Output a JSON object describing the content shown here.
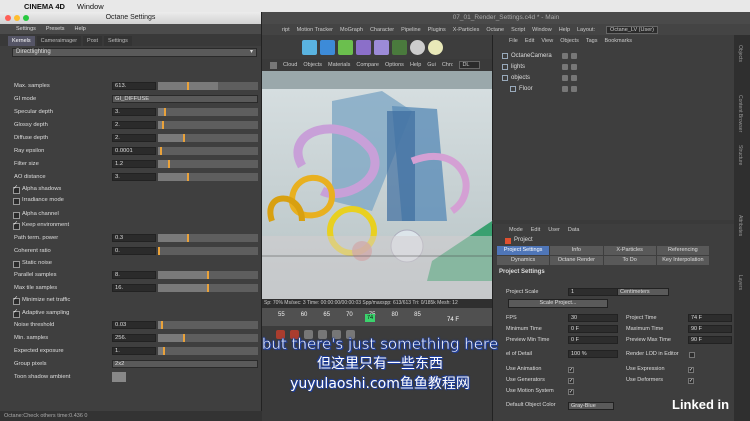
{
  "mac_menu": {
    "app": "CINEMA 4D",
    "window": "Window"
  },
  "c4d": {
    "title": "07_01_Render_Settings.c4d * - Main",
    "menus": [
      "ript",
      "Motion Tracker",
      "MoGraph",
      "Character",
      "Pipeline",
      "Plugins",
      "X-Particles",
      "Octane",
      "Script",
      "Window",
      "Help"
    ],
    "layout_label": "Layout:",
    "layout_value": "Octane_LV (User)"
  },
  "octane": {
    "title": "Octane Settings",
    "menu": [
      "Settings",
      "Presets",
      "Help"
    ],
    "tabs": [
      "Kernels",
      "Cameraimager",
      "Post",
      "Settings"
    ],
    "kernel": "Directlighting",
    "params": [
      {
        "label": "Max. samples",
        "value": "613.",
        "fill": 0.6,
        "mk": 0.3
      },
      {
        "label": "GI mode",
        "value": "GI_DIFFUSE",
        "select": true
      },
      {
        "label": "Specular depth",
        "value": "3.",
        "fill": 0.06,
        "mk": 0.06
      },
      {
        "label": "Glossy depth",
        "value": "2.",
        "fill": 0.04,
        "mk": 0.04
      },
      {
        "label": "Diffuse depth",
        "value": "2.",
        "fill": 0.25,
        "mk": 0.25
      },
      {
        "label": "Ray epsilon",
        "value": "0.0001",
        "fill": 0.02,
        "mk": 0.02
      },
      {
        "label": "Filter size",
        "value": "1.2",
        "fill": 0.1,
        "mk": 0.1
      },
      {
        "label": "AO distance",
        "value": "3.",
        "fill": 0.3,
        "mk": 0.3
      }
    ],
    "checks1": [
      {
        "label": "Alpha shadows",
        "on": true
      },
      {
        "label": "Irradiance mode",
        "on": false
      }
    ],
    "checks2": [
      {
        "label": "Alpha channel",
        "on": false
      },
      {
        "label": "Keep environment",
        "on": true
      }
    ],
    "params2": [
      {
        "label": "Path term. power",
        "value": "0.3",
        "fill": 0.3,
        "mk": 0.3
      },
      {
        "label": "Coherent ratio",
        "value": "0.",
        "fill": 0.0,
        "mk": 0.0
      }
    ],
    "check3": {
      "label": "Static noise",
      "on": false
    },
    "params3": [
      {
        "label": "Parallel samples",
        "value": "8.",
        "fill": 0.5,
        "mk": 0.5
      },
      {
        "label": "Max tile samples",
        "value": "16.",
        "fill": 0.5,
        "mk": 0.5
      }
    ],
    "check4": {
      "label": "Minimize net traffic",
      "on": true
    },
    "check5": {
      "label": "Adaptive sampling",
      "on": true
    },
    "params4": [
      {
        "label": "Noise threshold",
        "value": "0.03",
        "fill": 0.03,
        "mk": 0.03
      },
      {
        "label": "Min. samples",
        "value": "256.",
        "fill": 0.25,
        "mk": 0.25
      },
      {
        "label": "Expected exposure",
        "value": "1.",
        "fill": 0.05,
        "mk": 0.05
      }
    ],
    "group_pixels": {
      "label": "Group pixels",
      "value": "2x2"
    },
    "toon": {
      "label": "Toon shadow ambient"
    },
    "status": "Octane:Check others time:0.436  0"
  },
  "viewport": {
    "menu": [
      "Cloud",
      "Objects",
      "Materials",
      "Compare",
      "Options",
      "Help",
      "Gui"
    ],
    "chn_label": "Chn:",
    "chn_value": "DL",
    "stats": "Sp: 70%   Ms/sec: 3   Time: 00:00:00/00:00:03   Spp/maxspp: 613/613   Tri: 0/185k   Mesh: 12"
  },
  "timeline": {
    "nums": [
      "55",
      "60",
      "65",
      "70",
      "75",
      "80",
      "85"
    ],
    "current": "74",
    "end": "74 F"
  },
  "objects": {
    "menu": [
      "File",
      "Edit",
      "View",
      "Objects",
      "Tags",
      "Bookmarks"
    ],
    "items": [
      "OctaneCamera",
      "lights",
      "objects",
      "Floor"
    ]
  },
  "attributes": {
    "menu": [
      "Mode",
      "Edit",
      "User",
      "Data"
    ],
    "header": "Project",
    "tabs": [
      "Project Settings",
      "Info",
      "X-Particles",
      "Referencing",
      "Dynamics",
      "Octane Render",
      "To Do",
      "Key Interpolation"
    ],
    "section": "Project Settings",
    "scale_label": "Project Scale",
    "scale_value": "1",
    "scale_unit": "Centimeters",
    "scale_btn": "Scale Project...",
    "fields": [
      {
        "label": "FPS",
        "value": "30",
        "label2": "Project Time",
        "value2": "74 F"
      },
      {
        "label": "Minimum Time",
        "value": "0 F",
        "label2": "Maximum Time",
        "value2": "90 F"
      },
      {
        "label": "Preview Min Time",
        "value": "0 F",
        "label2": "Preview Max Time",
        "value2": "90 F"
      }
    ],
    "lod_label": "el of Detail",
    "lod_value": "100 %",
    "lod_check": "Render LOD in Editor",
    "checks": [
      {
        "label": "Use Animation",
        "label2": "Use Expression"
      },
      {
        "label": "Use Generators",
        "label2": "Use Deformers"
      },
      {
        "label": "Use Motion System",
        "label2": ""
      }
    ],
    "color_label": "Default Object Color",
    "color_value": "Gray-Blue"
  },
  "side_tabs": [
    "Objects",
    "Content Browser",
    "Structure",
    "Attributes",
    "Layers"
  ],
  "subtitles": {
    "en": "but there's just something here",
    "zh": "但这里只有一些东西",
    "wm": "yuyulaoshi.com鱼鱼教程网"
  },
  "logo": "Linked in"
}
